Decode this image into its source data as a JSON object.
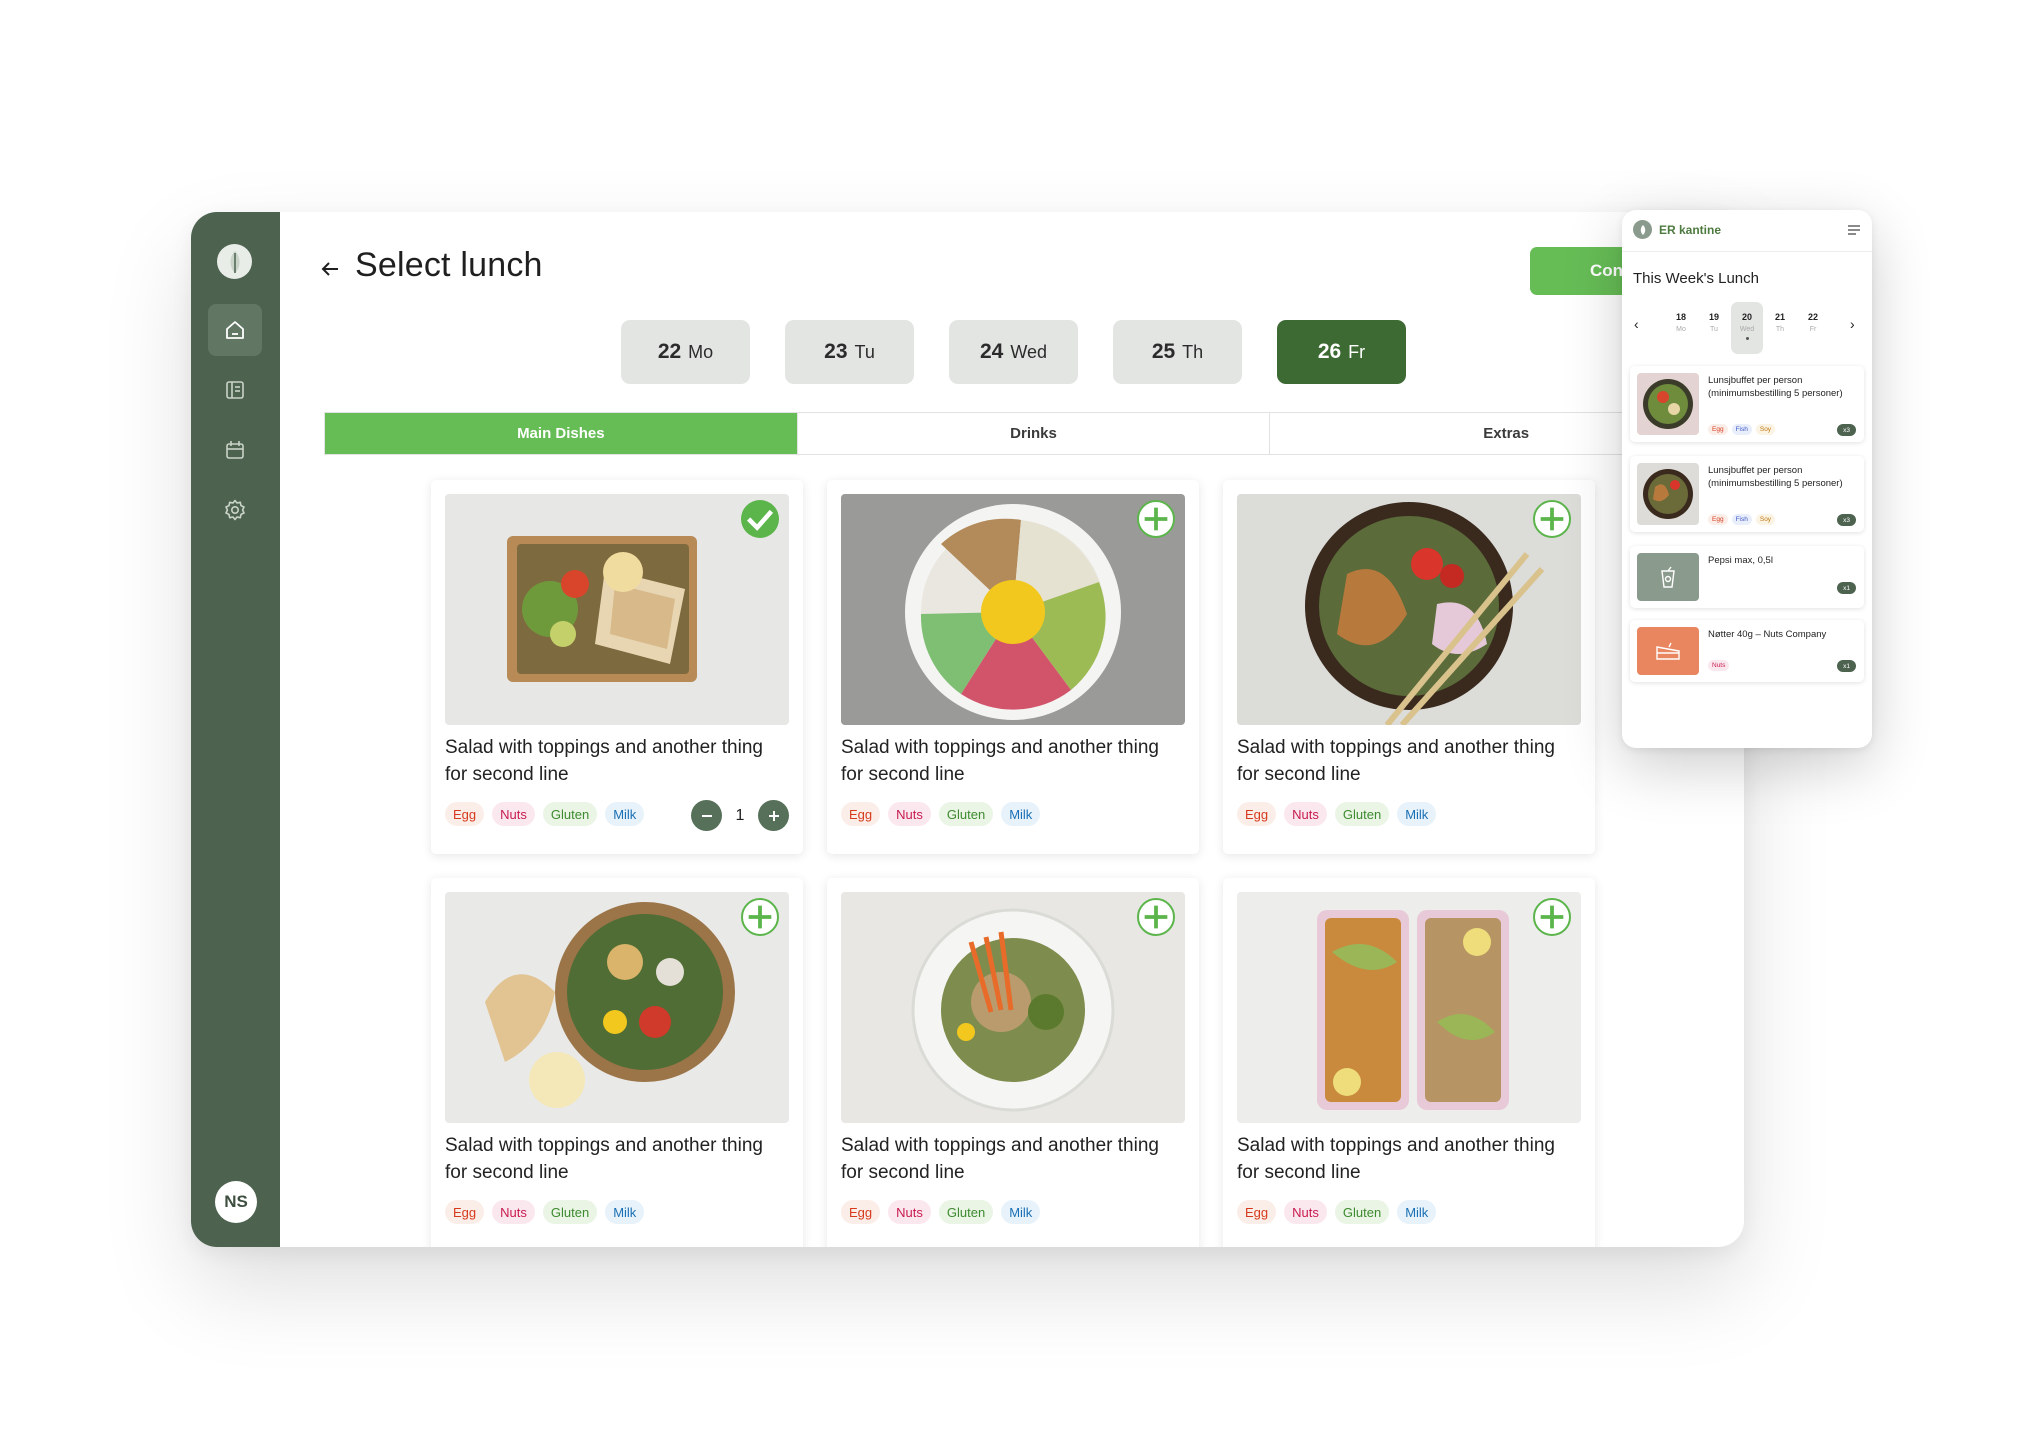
{
  "page": {
    "title": "Select lunch",
    "continue_label": "Con"
  },
  "sidebar": {
    "avatar_initials": "NS"
  },
  "days": [
    {
      "num": "22",
      "name": "Mo"
    },
    {
      "num": "23",
      "name": "Tu"
    },
    {
      "num": "24",
      "name": "Wed"
    },
    {
      "num": "25",
      "name": "Th"
    },
    {
      "num": "26",
      "name": "Fr"
    }
  ],
  "tabs": [
    "Main Dishes",
    "Drinks",
    "Extras"
  ],
  "dishes": [
    {
      "name": "Salad with toppings and another thing for second line",
      "selected": true,
      "quantity": "1"
    },
    {
      "name": "Salad with toppings and another thing for second line"
    },
    {
      "name": "Salad with toppings and another thing for second line"
    },
    {
      "name": "Salad with toppings and another thing for second line"
    },
    {
      "name": "Salad with toppings and another thing for second line"
    },
    {
      "name": "Salad with toppings and another thing for second line"
    }
  ],
  "allergens": [
    "Egg",
    "Nuts",
    "Gluten",
    "Milk"
  ],
  "colors": {
    "sidebar": "#4d6350",
    "accent": "#66bd56",
    "active_day": "#3d6a33"
  },
  "mobile": {
    "brand": "ER kantine",
    "title": "This Week's Lunch",
    "days": [
      {
        "num": "18",
        "name": "Mo"
      },
      {
        "num": "19",
        "name": "Tu"
      },
      {
        "num": "20",
        "name": "Wed"
      },
      {
        "num": "21",
        "name": "Th"
      },
      {
        "num": "22",
        "name": "Fr"
      }
    ],
    "items": [
      {
        "name": "Lunsjbuffet per person (minimumsbestilling 5 personer)",
        "tags": [
          "Egg",
          "Fish",
          "Soy"
        ],
        "qty": "x3"
      },
      {
        "name": "Lunsjbuffet per person (minimumsbestilling 5 personer)",
        "tags": [
          "Egg",
          "Fish",
          "Soy"
        ],
        "qty": "x3"
      },
      {
        "name": "Pepsi max, 0,5l",
        "tags": [],
        "qty": "x1"
      },
      {
        "name": "Nøtter 40g – Nuts Company",
        "tags": [
          "Nuts"
        ],
        "qty": "x1"
      }
    ]
  }
}
